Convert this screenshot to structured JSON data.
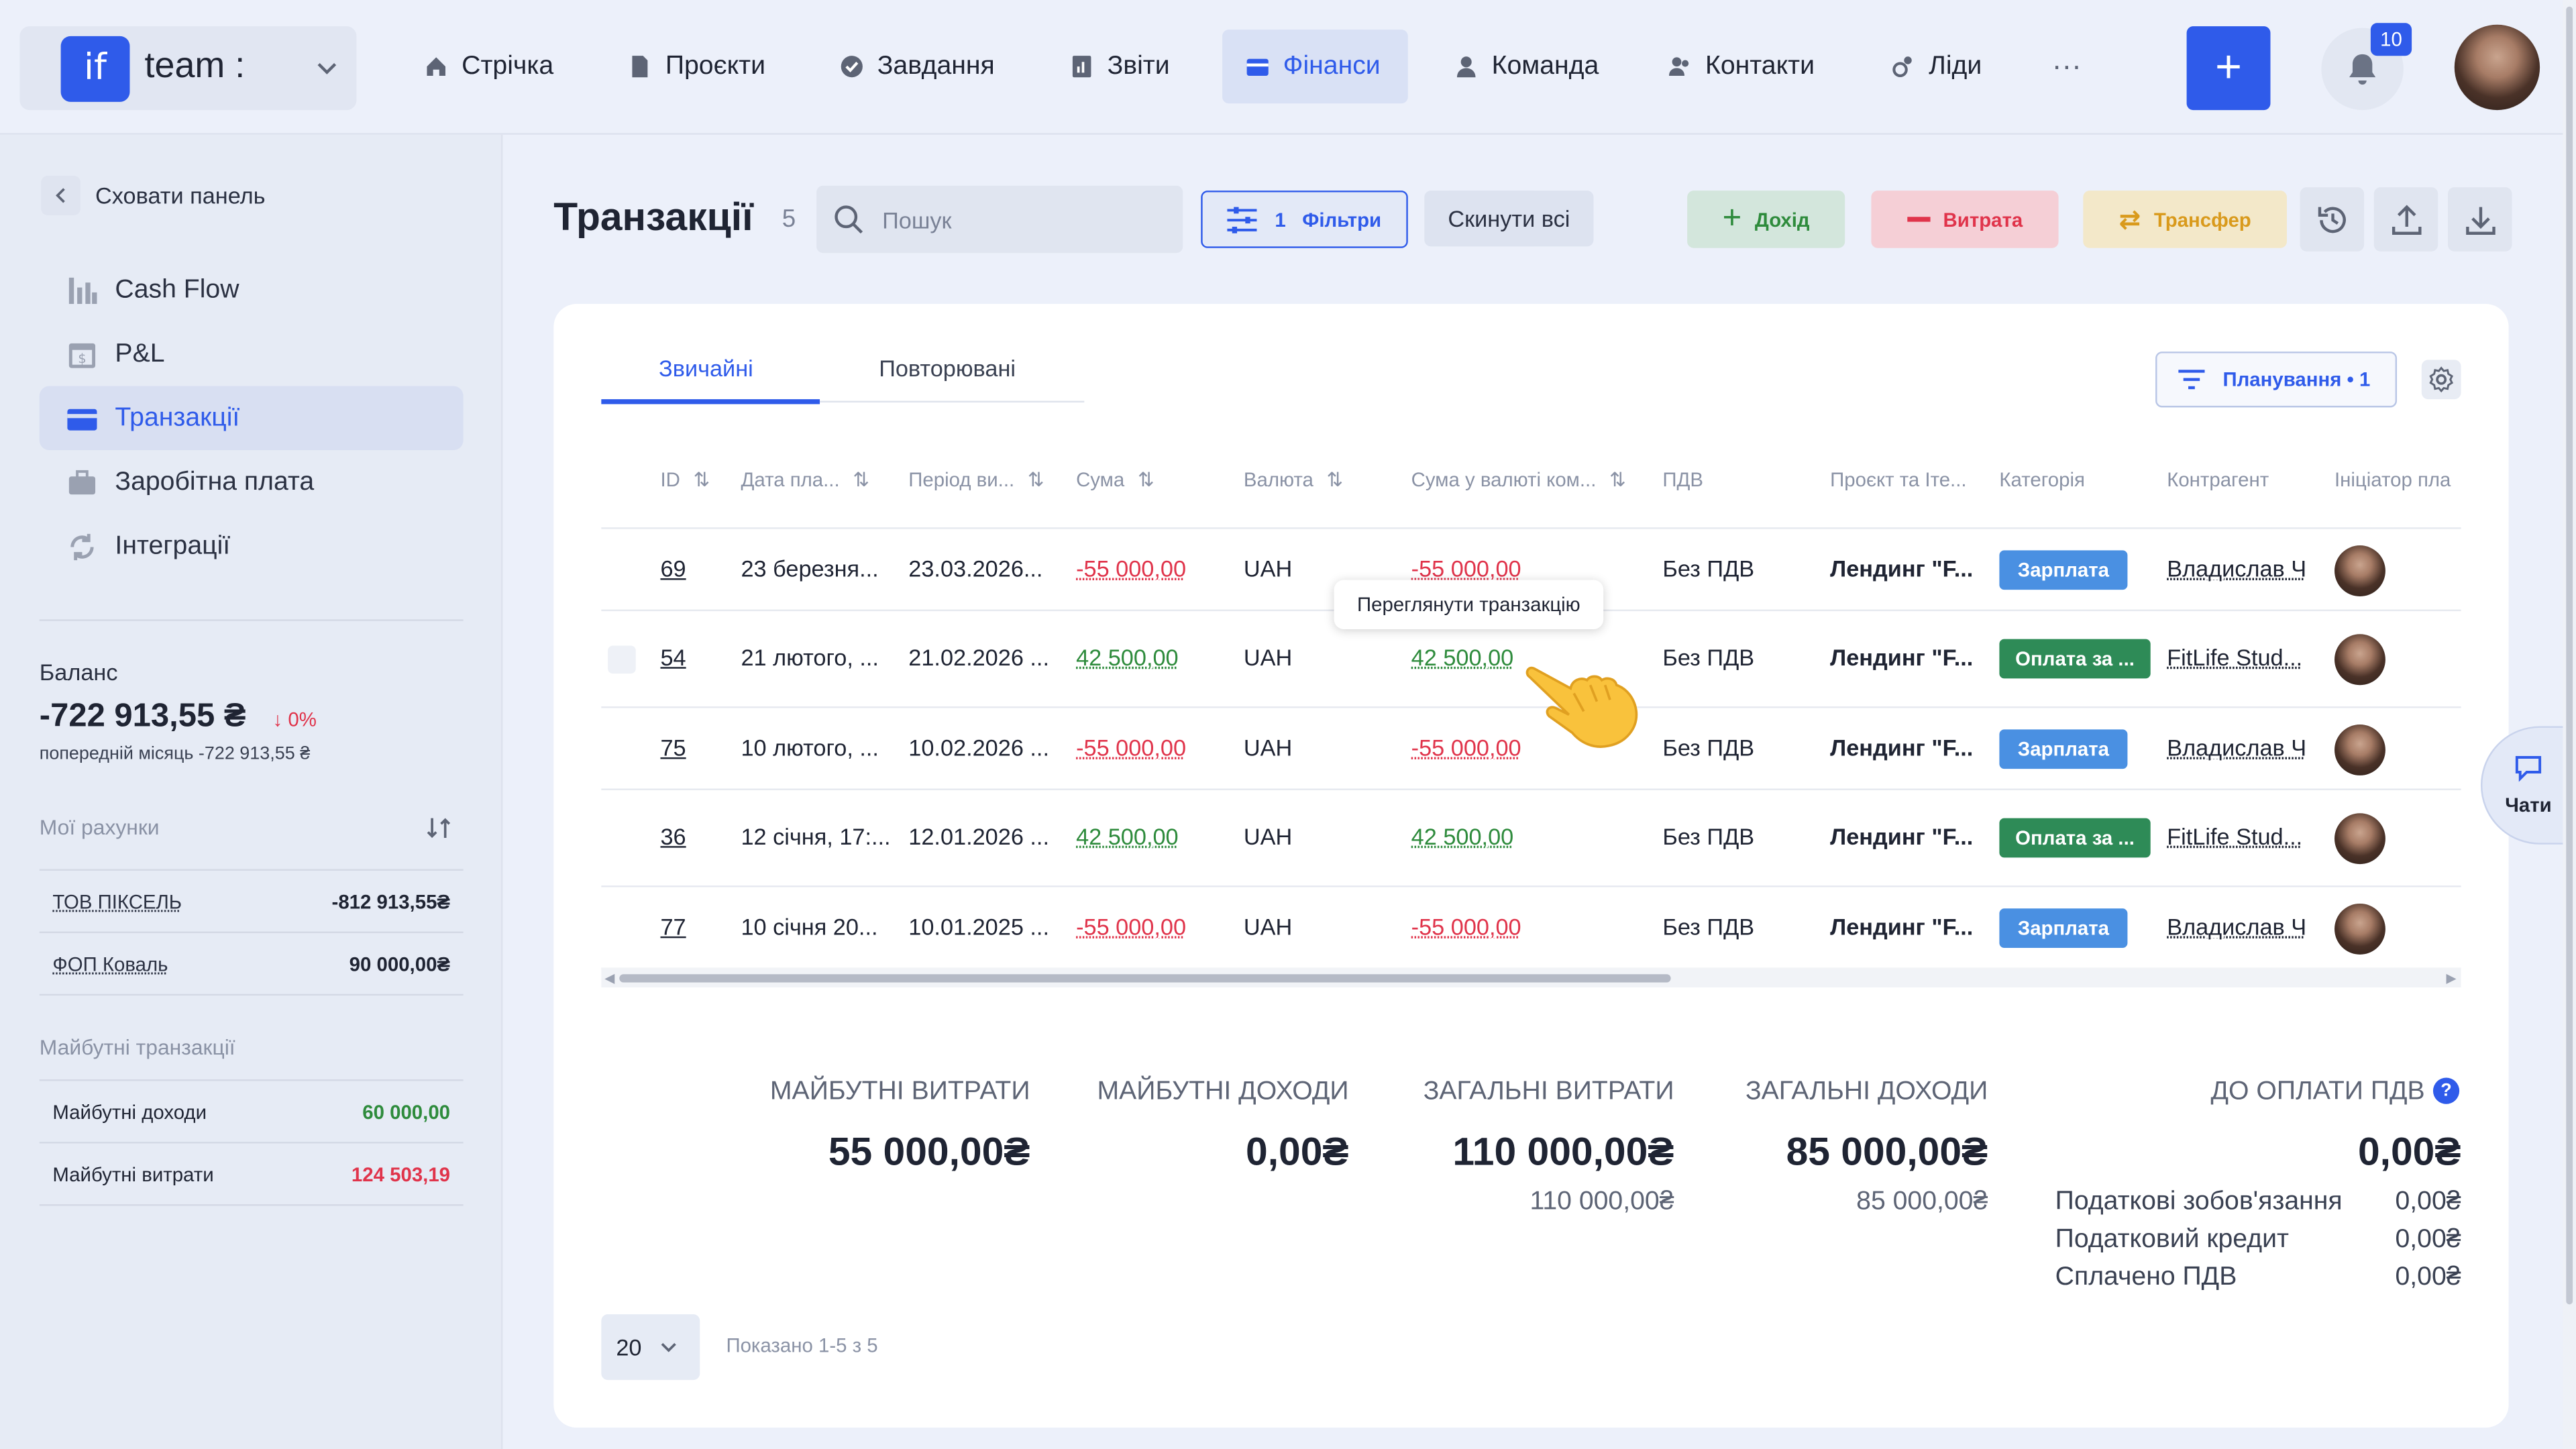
{
  "header": {
    "logo_text": "if",
    "workspace_name": "team :",
    "nav": [
      {
        "label": "Стрічка",
        "icon": "home-icon"
      },
      {
        "label": "Проєкти",
        "icon": "document-icon"
      },
      {
        "label": "Завдання",
        "icon": "check-circle-icon"
      },
      {
        "label": "Звіти",
        "icon": "report-icon"
      },
      {
        "label": "Фінанси",
        "icon": "wallet-icon",
        "active": true
      },
      {
        "label": "Команда",
        "icon": "person-icon"
      },
      {
        "label": "Контакти",
        "icon": "contacts-icon"
      },
      {
        "label": "Ліди",
        "icon": "leads-icon"
      }
    ],
    "more_label": "···",
    "add_label": "+",
    "notifications_count": "10"
  },
  "sidebar": {
    "hide_label": "Сховати панель",
    "items": [
      {
        "label": "Cash Flow",
        "icon": "bar-chart-icon"
      },
      {
        "label": "P&L",
        "icon": "calendar-dollar-icon"
      },
      {
        "label": "Транзакції",
        "icon": "card-icon",
        "active": true
      },
      {
        "label": "Заробітна плата",
        "icon": "briefcase-icon"
      },
      {
        "label": "Інтеграції",
        "icon": "sync-icon"
      }
    ],
    "balance_label": "Баланс",
    "balance_value": "-722 913,55 ₴",
    "balance_delta": "0%",
    "balance_prev": "попередній місяць -722 913,55 ₴",
    "accounts_title": "Мої рахунки",
    "accounts": [
      {
        "name": "ТОВ ПІКСЕЛЬ",
        "value": "-812 913,55₴"
      },
      {
        "name": "ФОП Коваль",
        "value": "90 000,00₴"
      }
    ],
    "future_title": "Майбутні транзакції",
    "future": [
      {
        "name": "Майбутні доходи",
        "value": "60 000,00",
        "color": "#2e8b3c"
      },
      {
        "name": "Майбутні витрати",
        "value": "124 503,19",
        "color": "#e0344b"
      }
    ]
  },
  "page": {
    "title": "Транзакції",
    "count": "5",
    "search_placeholder": "Пошук",
    "filter_count": "1",
    "filter_label": "Фільтри",
    "reset_label": "Скинути всі",
    "income_label": "Дохід",
    "expense_label": "Витрата",
    "transfer_label": "Трансфер"
  },
  "tabs": {
    "regular": "Звичайні",
    "recurring": "Повторювані"
  },
  "planning_label": "Планування • 1",
  "table": {
    "headers": [
      "ID",
      "Дата пла...",
      "Період ви...",
      "Сума",
      "Валюта",
      "Сума у валюті ком...",
      "ПДВ",
      "Проєкт та Іте...",
      "Категорія",
      "Контрагент",
      "Ініціатор пла"
    ],
    "rows": [
      {
        "id": "69",
        "date": "23 березня...",
        "period": "23.03.2026...",
        "sum": "-55 000,00",
        "currency": "UAH",
        "sum_company": "-55 000,00",
        "vat": "Без ПДВ",
        "project": "Лендинг \"F...",
        "category": "Зарплата",
        "category_color": "#4a90e2",
        "counterparty": "Владислав Ч",
        "sign": "neg"
      },
      {
        "id": "54",
        "date": "21 лютого, ...",
        "period": "21.02.2026 ...",
        "sum": "42 500,00",
        "currency": "UAH",
        "sum_company": "42 500,00",
        "vat": "Без ПДВ",
        "project": "Лендинг \"F...",
        "category": "Оплата за ...",
        "category_color": "#2e8b57",
        "counterparty": "FitLife Stud...",
        "sign": "pos"
      },
      {
        "id": "75",
        "date": "10 лютого, ...",
        "period": "10.02.2026 ...",
        "sum": "-55 000,00",
        "currency": "UAH",
        "sum_company": "-55 000,00",
        "vat": "Без ПДВ",
        "project": "Лендинг \"F...",
        "category": "Зарплата",
        "category_color": "#4a90e2",
        "counterparty": "Владислав Ч",
        "sign": "neg"
      },
      {
        "id": "36",
        "date": "12 січня, 17:...",
        "period": "12.01.2026 ...",
        "sum": "42 500,00",
        "currency": "UAH",
        "sum_company": "42 500,00",
        "vat": "Без ПДВ",
        "project": "Лендинг \"F...",
        "category": "Оплата за ...",
        "category_color": "#2e8b57",
        "counterparty": "FitLife Stud...",
        "sign": "pos"
      },
      {
        "id": "77",
        "date": "10 січня 20...",
        "period": "10.01.2025 ...",
        "sum": "-55 000,00",
        "currency": "UAH",
        "sum_company": "-55 000,00",
        "vat": "Без ПДВ",
        "project": "Лендинг \"F...",
        "category": "Зарплата",
        "category_color": "#4a90e2",
        "counterparty": "Владислав Ч",
        "sign": "neg"
      }
    ],
    "tooltip": "Переглянути транзакцію"
  },
  "summary": {
    "future_expenses_label": "МАЙБУТНІ ВИТРАТИ",
    "future_expenses_value": "55 000,00₴",
    "future_income_label": "МАЙБУТНІ ДОХОДИ",
    "future_income_value": "0,00₴",
    "total_expenses_label": "ЗАГАЛЬНІ ВИТРАТИ",
    "total_expenses_value": "110 000,00₴",
    "total_expenses_sub": "110 000,00₴",
    "total_income_label": "ЗАГАЛЬНІ ДОХОДИ",
    "total_income_value": "85 000,00₴",
    "total_income_sub": "85 000,00₴",
    "vat_label": "ДО ОПЛАТИ ПДВ",
    "vat_value": "0,00₴",
    "tax_lines": [
      {
        "label": "Податкові зобов'язання",
        "value": "0,00₴"
      },
      {
        "label": "Податковий кредит",
        "value": "0,00₴"
      },
      {
        "label": "Сплачено ПДВ",
        "value": "0,00₴"
      }
    ]
  },
  "pagination": {
    "per_page": "20",
    "shown": "Показано 1-5 з 5"
  },
  "chat_label": "Чати"
}
